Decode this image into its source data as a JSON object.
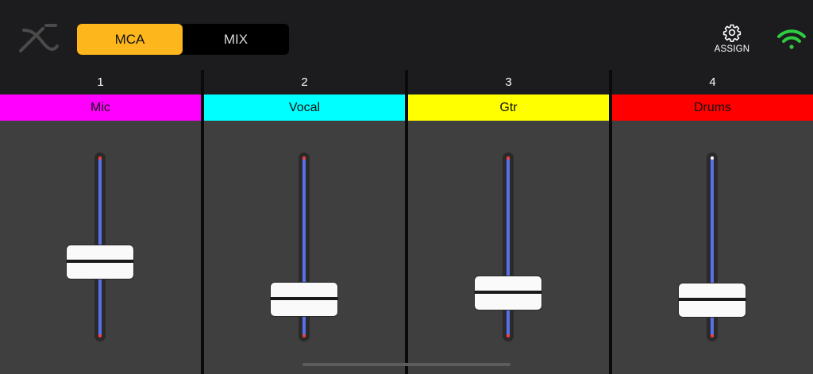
{
  "header": {
    "logo_icon": "x-logo-icon",
    "modes": [
      {
        "label": "MCA",
        "active": true,
        "color": "#fdb71c"
      },
      {
        "label": "MIX",
        "active": false
      }
    ],
    "assign_label": "ASSIGN",
    "assign_icon": "gear-icon",
    "wifi_icon": "wifi-icon",
    "wifi_color": "#2ecc40"
  },
  "channels": [
    {
      "number": "1",
      "name": "Mic",
      "color": "#ff00ff",
      "fader_level": 0.42
    },
    {
      "number": "2",
      "name": "Vocal",
      "color": "#00ffff",
      "fader_level": 0.22
    },
    {
      "number": "3",
      "name": "Gtr",
      "color": "#ffff00",
      "fader_level": 0.25
    },
    {
      "number": "4",
      "name": "Drums",
      "color": "#ff0000",
      "fader_level": 0.21
    }
  ]
}
